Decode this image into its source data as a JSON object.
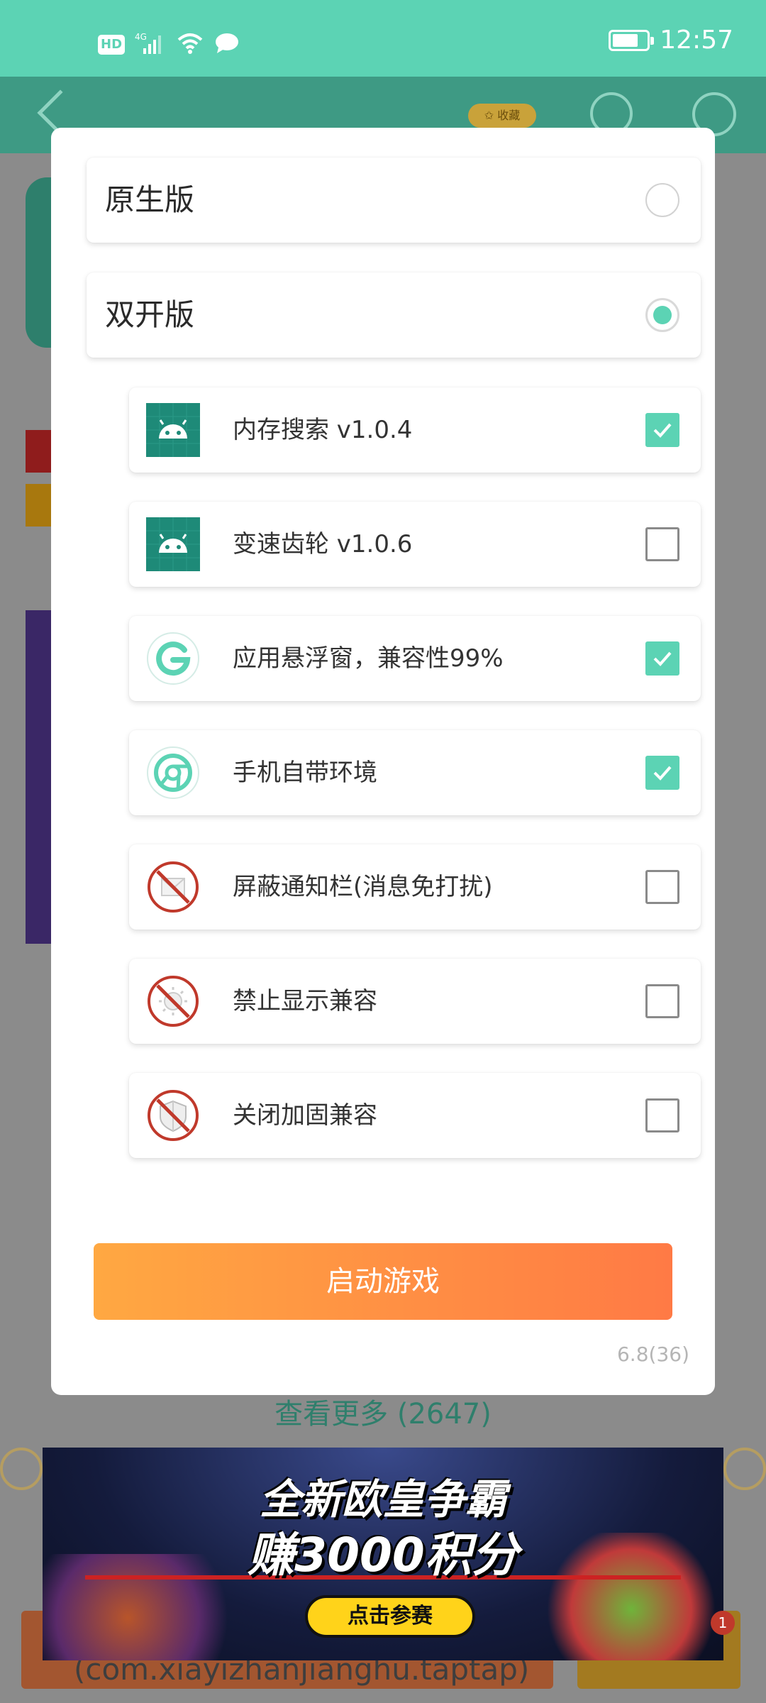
{
  "status_bar": {
    "hd_badge": "HD",
    "network": "4G",
    "time": "12:57",
    "battery_level_pct": 75
  },
  "app_bar": {
    "favorite_label": "✩ 收藏"
  },
  "background": {
    "see_more_label": "查看更多 (2647)",
    "package_name": "(com.xiayizhanjianghu.taptap)",
    "notification_count": "1"
  },
  "dialog": {
    "options": [
      {
        "label": "原生版",
        "selected": false
      },
      {
        "label": "双开版",
        "selected": true
      }
    ],
    "plugins": [
      {
        "label": "内存搜索 v1.0.4",
        "icon": "android-icon",
        "checked": true
      },
      {
        "label": "变速齿轮 v1.0.6",
        "icon": "android-icon",
        "checked": false
      },
      {
        "label": "应用悬浮窗，兼容性99%",
        "icon": "g-logo-icon",
        "checked": true
      },
      {
        "label": "手机自带环境",
        "icon": "chrome-icon",
        "checked": true
      },
      {
        "label": "屏蔽通知栏(消息免打扰)",
        "icon": "no-notification-icon",
        "checked": false
      },
      {
        "label": "禁止显示兼容",
        "icon": "no-display-icon",
        "checked": false
      },
      {
        "label": "关闭加固兼容",
        "icon": "no-shield-icon",
        "checked": false
      }
    ],
    "launch_button": "启动游戏",
    "version": "6.8(36)"
  },
  "ad": {
    "line1": "全新欧皇争霸",
    "line2": "赚3000积分",
    "button": "点击参赛"
  },
  "colors": {
    "accent": "#5cd3b4",
    "status_bar": "#5cd3b4",
    "launch_gradient_start": "#ffa842",
    "launch_gradient_end": "#ff7a45",
    "forbidden_red": "#c0392b"
  }
}
